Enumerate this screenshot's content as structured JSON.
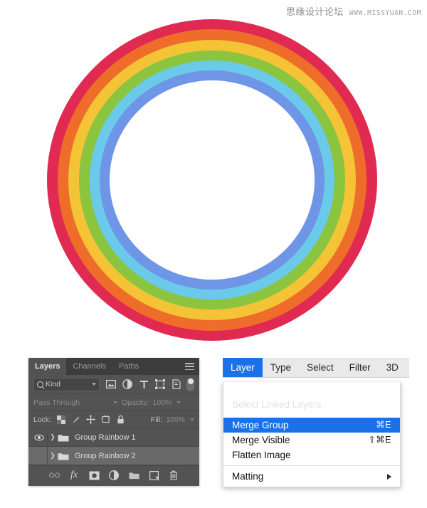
{
  "watermark": {
    "site_cn": "思缘设计论坛",
    "site_url": "WWW.MISSYUAN.COM"
  },
  "artwork": {
    "name": "rainbow-ring",
    "shape": "concentric-ring",
    "bands": [
      {
        "name": "red",
        "color": "#e12a52"
      },
      {
        "name": "orange",
        "color": "#ee6d2b"
      },
      {
        "name": "yellow",
        "color": "#f4c336"
      },
      {
        "name": "green",
        "color": "#8bc53f"
      },
      {
        "name": "light-blue",
        "color": "#6bc9ea"
      },
      {
        "name": "blue",
        "color": "#6f95e6"
      }
    ],
    "inner_fill": "#ffffff"
  },
  "layers_panel": {
    "tabs": [
      {
        "label": "Layers",
        "active": true
      },
      {
        "label": "Channels",
        "active": false
      },
      {
        "label": "Paths",
        "active": false
      }
    ],
    "menu_icon": "hamburger-icon",
    "filter": {
      "kind_label": "Kind",
      "search_icon": "search-icon",
      "icons": [
        {
          "name": "pixel-layer-filter-icon"
        },
        {
          "name": "adjustment-layer-filter-icon"
        },
        {
          "name": "type-layer-filter-icon"
        },
        {
          "name": "shape-layer-filter-icon"
        },
        {
          "name": "smart-object-filter-icon"
        }
      ],
      "toggle_name": "filter-toggle"
    },
    "blend": {
      "mode": "Pass Through",
      "opacity_label": "Opacity:",
      "opacity_value": "100%"
    },
    "lock": {
      "label": "Lock:",
      "icons": [
        {
          "name": "lock-transparent-pixels-icon"
        },
        {
          "name": "lock-image-pixels-icon"
        },
        {
          "name": "lock-position-icon"
        },
        {
          "name": "lock-artboard-nesting-icon"
        },
        {
          "name": "lock-all-icon"
        }
      ],
      "fill_label": "Fill:",
      "fill_value": "100%"
    },
    "layers": [
      {
        "name": "Group Rainbow 1",
        "visible": true,
        "selected": false,
        "type": "group"
      },
      {
        "name": "Group Rainbow 2",
        "visible": false,
        "selected": true,
        "type": "group"
      }
    ],
    "footer_icons": [
      {
        "name": "link-layers-icon"
      },
      {
        "name": "layer-effects-fx-icon"
      },
      {
        "name": "add-layer-mask-icon"
      },
      {
        "name": "new-adjustment-layer-icon"
      },
      {
        "name": "new-group-icon"
      },
      {
        "name": "new-layer-icon"
      },
      {
        "name": "delete-layer-icon"
      }
    ]
  },
  "menu": {
    "menubar": [
      {
        "label": "Layer",
        "active": true
      },
      {
        "label": "Type",
        "active": false
      },
      {
        "label": "Select",
        "active": false
      },
      {
        "label": "Filter",
        "active": false
      },
      {
        "label": "3D",
        "active": false
      }
    ],
    "dropdown": {
      "ghost_items": [
        {
          "label": "Select Linked Layers"
        }
      ],
      "items": [
        {
          "label": "Merge Group",
          "shortcut": "⌘E",
          "highlight": true
        },
        {
          "label": "Merge Visible",
          "shortcut": "⇧⌘E",
          "highlight": false
        },
        {
          "label": "Flatten Image",
          "shortcut": "",
          "highlight": false
        }
      ],
      "after_separator": [
        {
          "label": "Matting",
          "submenu": true
        }
      ]
    }
  },
  "colors": {
    "accent_blue": "#1b72e8",
    "panel_bg": "#535353",
    "panel_tabbar": "#3d3d3d",
    "row_selected": "#6a6a6a"
  }
}
